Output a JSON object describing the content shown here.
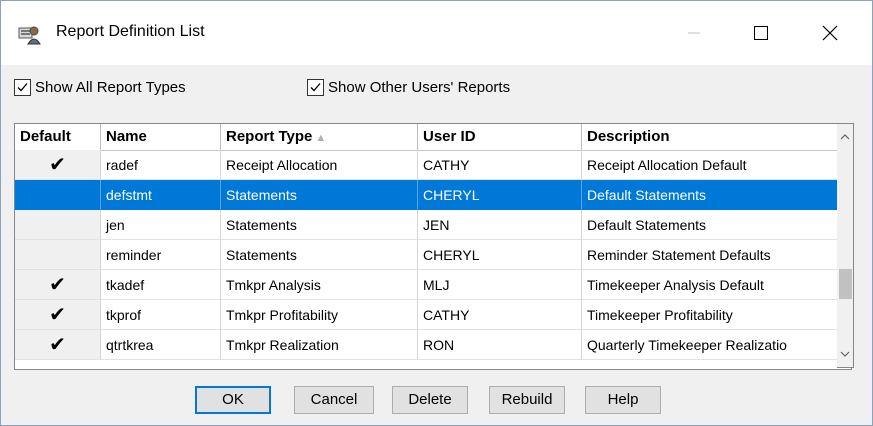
{
  "window": {
    "title": "Report Definition List"
  },
  "options": {
    "show_all_report_types": {
      "label": "Show All Report Types",
      "checked": true
    },
    "show_other_users_reports": {
      "label": "Show Other Users' Reports",
      "checked": true
    }
  },
  "grid": {
    "columns": [
      "Default",
      "Name",
      "Report Type",
      "User ID",
      "Description"
    ],
    "sorted_column": "Report Type",
    "rows": [
      {
        "default": "✔",
        "name": "radef",
        "report_type": "Receipt Allocation",
        "user_id": "CATHY",
        "description": "Receipt Allocation Default"
      },
      {
        "default": "",
        "name": "defstmt",
        "report_type": "Statements",
        "user_id": "CHERYL",
        "description": "Default Statements",
        "selected": true
      },
      {
        "default": "",
        "name": "jen",
        "report_type": "Statements",
        "user_id": "JEN",
        "description": "Default Statements"
      },
      {
        "default": "",
        "name": "reminder",
        "report_type": "Statements",
        "user_id": "CHERYL",
        "description": "Reminder Statement Defaults"
      },
      {
        "default": "✔",
        "name": "tkadef",
        "report_type": "Tmkpr Analysis",
        "user_id": "MLJ",
        "description": "Timekeeper Analysis Default"
      },
      {
        "default": "✔",
        "name": "tkprof",
        "report_type": "Tmkpr Profitability",
        "user_id": "CATHY",
        "description": "Timekeeper Profitability"
      },
      {
        "default": "✔",
        "name": "qtrtkrea",
        "report_type": "Tmkpr Realization",
        "user_id": "RON",
        "description": "Quarterly Timekeeper Realizatio"
      }
    ]
  },
  "buttons": {
    "ok": "OK",
    "cancel": "Cancel",
    "delete": "Delete",
    "rebuild": "Rebuild",
    "help": "Help"
  },
  "colors": {
    "selection": "#0078d7",
    "window_bg": "#f0f0f0"
  }
}
